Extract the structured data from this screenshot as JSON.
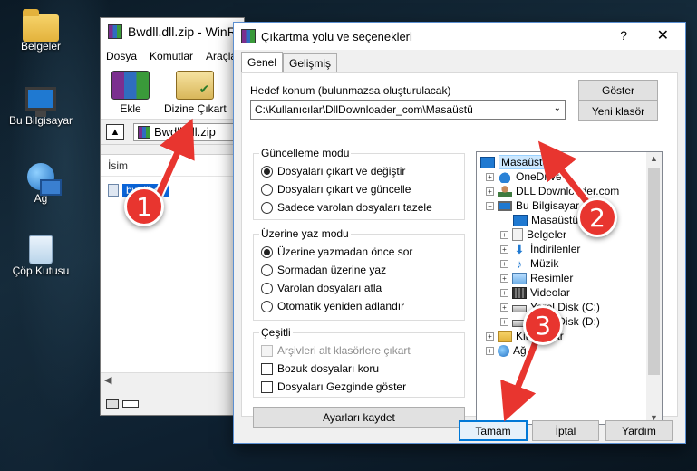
{
  "desktop": {
    "icons": [
      {
        "label": "Belgeler",
        "icon": "folder-icon"
      },
      {
        "label": "Bu Bilgisayar",
        "icon": "computer-icon"
      },
      {
        "label": "Ağ",
        "icon": "network-icon"
      },
      {
        "label": "Çöp Kutusu",
        "icon": "recycle-bin-icon"
      }
    ]
  },
  "winrar": {
    "title": "Bwdll.dll.zip - WinRAR",
    "menu": [
      "Dosya",
      "Komutlar",
      "Araçlar"
    ],
    "toolbar": {
      "add_label": "Ekle",
      "extract_label": "Dizine Çıkart"
    },
    "path": "Bwdll.dll.zip",
    "column_name": "İsim",
    "file": "bwdll.dll"
  },
  "dialog": {
    "title": "Çıkartma yolu ve seçenekleri",
    "help": "?",
    "close": "✕",
    "tabs": [
      "Genel",
      "Gelişmiş"
    ],
    "dest_label": "Hedef konum (bulunmazsa oluşturulacak)",
    "dest_value": "C:\\Kullanıcılar\\DllDownloader_com\\Masaüstü",
    "show_button": "Göster",
    "new_folder_button": "Yeni klasör",
    "update_mode": {
      "title": "Güncelleme modu",
      "options": [
        {
          "label": "Dosyaları çıkart ve değiştir",
          "selected": true
        },
        {
          "label": "Dosyaları çıkart ve güncelle",
          "selected": false
        },
        {
          "label": "Sadece varolan dosyaları tazele",
          "selected": false
        }
      ]
    },
    "overwrite_mode": {
      "title": "Üzerine yaz modu",
      "options": [
        {
          "label": "Üzerine yazmadan önce sor",
          "selected": true
        },
        {
          "label": "Sormadan üzerine yaz",
          "selected": false
        },
        {
          "label": "Varolan dosyaları atla",
          "selected": false
        },
        {
          "label": "Otomatik yeniden adlandır",
          "selected": false
        }
      ]
    },
    "misc": {
      "title": "Çeşitli",
      "options": [
        {
          "label": "Arşivleri alt klasörlere çıkart",
          "checked": false,
          "disabled": true
        },
        {
          "label": "Bozuk dosyaları koru",
          "checked": false,
          "disabled": false
        },
        {
          "label": "Dosyaları Gezginde göster",
          "checked": false,
          "disabled": false
        }
      ]
    },
    "save_settings_button": "Ayarları kaydet",
    "tree": [
      {
        "label": "Masaüstü",
        "level": 0,
        "expander": "",
        "icon": "desktop-icon",
        "selected": true
      },
      {
        "label": "OneDrive",
        "level": 1,
        "expander": "+",
        "icon": "onedrive-icon"
      },
      {
        "label": "DLL Downloader.com",
        "level": 1,
        "expander": "+",
        "icon": "user-icon"
      },
      {
        "label": "Bu Bilgisayar",
        "level": 1,
        "expander": "−",
        "icon": "computer-icon"
      },
      {
        "label": "Masaüstü",
        "level": 2,
        "expander": "",
        "icon": "desktop-icon"
      },
      {
        "label": "Belgeler",
        "level": 2,
        "expander": "+",
        "icon": "document-icon"
      },
      {
        "label": "İndirilenler",
        "level": 2,
        "expander": "+",
        "icon": "download-icon"
      },
      {
        "label": "Müzik",
        "level": 2,
        "expander": "+",
        "icon": "music-icon"
      },
      {
        "label": "Resimler",
        "level": 2,
        "expander": "+",
        "icon": "pictures-icon"
      },
      {
        "label": "Videolar",
        "level": 2,
        "expander": "+",
        "icon": "videos-icon"
      },
      {
        "label": "Yerel Disk (C:)",
        "level": 2,
        "expander": "+",
        "icon": "disk-icon"
      },
      {
        "label": "Yerel Disk (D:)",
        "level": 2,
        "expander": "+",
        "icon": "disk-icon"
      },
      {
        "label": "Kitaplıklar",
        "level": 1,
        "expander": "+",
        "icon": "libraries-icon"
      },
      {
        "label": "Ağ",
        "level": 1,
        "expander": "+",
        "icon": "network-icon"
      }
    ],
    "ok_button": "Tamam",
    "cancel_button": "İptal",
    "help_button": "Yardım"
  },
  "annotations": {
    "step1": "1",
    "step2": "2",
    "step3": "3",
    "arrow_color": "#e8352f"
  }
}
